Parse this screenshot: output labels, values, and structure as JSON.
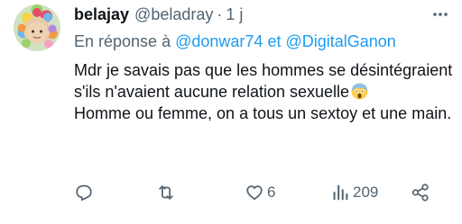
{
  "tweet": {
    "author_name": "belajay",
    "author_handle": "@beladray",
    "separator": "·",
    "time": "1 j",
    "reply_prefix": "En réponse à",
    "reply_mention_1": "@donwar74",
    "reply_conjunction": "et",
    "reply_mention_2": "@DigitalGanon",
    "text_line_1": "Mdr je savais pas que les hommes se désintégraient s'ils n'avaient aucune relation sexuelle",
    "text_line_2": "Homme ou femme, on a tous un sextoy et une main.",
    "emoji": "face-screaming-in-fear"
  },
  "actions": {
    "reply_count": "",
    "retweet_count": "",
    "like_count": "6",
    "view_count": "209"
  },
  "icons": {
    "more": "more-icon",
    "reply": "reply-icon",
    "retweet": "retweet-icon",
    "like": "heart-icon",
    "views": "views-icon",
    "share": "share-icon"
  },
  "colors": {
    "text": "#0f1419",
    "secondary": "#536471",
    "link": "#1d9bf0"
  }
}
